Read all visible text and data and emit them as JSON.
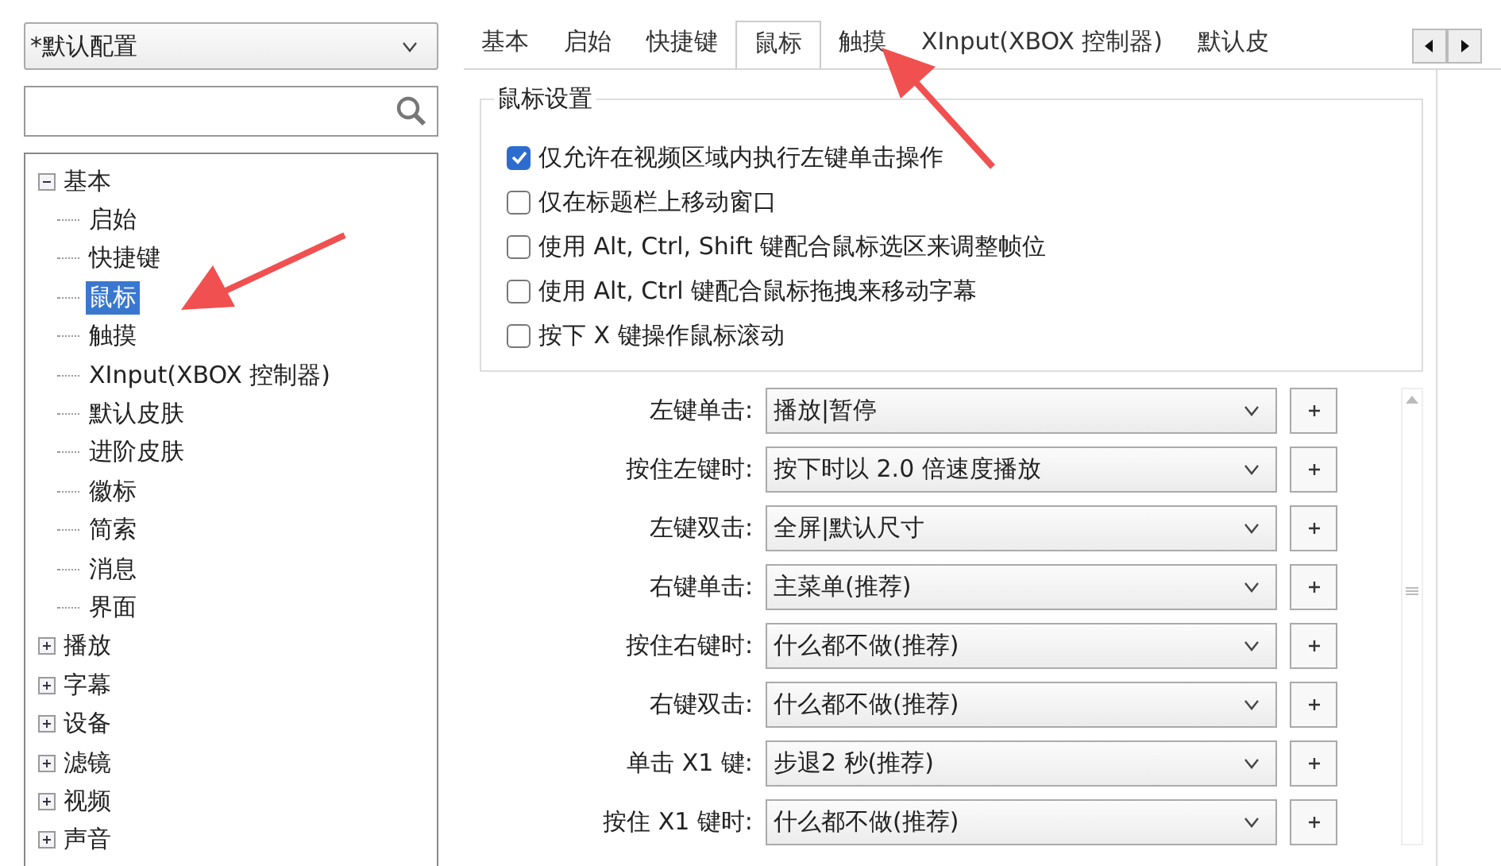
{
  "profile_select": {
    "value": "*默认配置"
  },
  "tree": [
    {
      "label": "基本",
      "expanded": true,
      "selected": false,
      "children": [
        {
          "label": "启始",
          "selected": false
        },
        {
          "label": "快捷键",
          "selected": false
        },
        {
          "label": "鼠标",
          "selected": true
        },
        {
          "label": "触摸",
          "selected": false
        },
        {
          "label": "XInput(XBOX 控制器)",
          "selected": false
        },
        {
          "label": "默认皮肤",
          "selected": false
        },
        {
          "label": "进阶皮肤",
          "selected": false
        },
        {
          "label": "徽标",
          "selected": false
        },
        {
          "label": "简索",
          "selected": false
        },
        {
          "label": "消息",
          "selected": false
        },
        {
          "label": "界面",
          "selected": false
        }
      ]
    },
    {
      "label": "播放",
      "expanded": false,
      "selected": false
    },
    {
      "label": "字幕",
      "expanded": false,
      "selected": false
    },
    {
      "label": "设备",
      "expanded": false,
      "selected": false
    },
    {
      "label": "滤镜",
      "expanded": false,
      "selected": false
    },
    {
      "label": "视频",
      "expanded": false,
      "selected": false
    },
    {
      "label": "声音",
      "expanded": false,
      "selected": false
    }
  ],
  "tabs": [
    {
      "label": "基本",
      "selected": false
    },
    {
      "label": "启始",
      "selected": false
    },
    {
      "label": "快捷键",
      "selected": false
    },
    {
      "label": "鼠标",
      "selected": true
    },
    {
      "label": "触摸",
      "selected": false
    },
    {
      "label": "XInput(XBOX 控制器)",
      "selected": false
    },
    {
      "label": "默认皮",
      "selected": false
    }
  ],
  "group": {
    "title": "鼠标设置",
    "options": [
      {
        "label": "仅允许在视频区域内执行左键单击操作",
        "checked": true
      },
      {
        "label": "仅在标题栏上移动窗口",
        "checked": false
      },
      {
        "label": "使用 Alt, Ctrl, Shift 键配合鼠标选区来调整帧位",
        "checked": false
      },
      {
        "label": "使用 Alt, Ctrl 键配合鼠标拖拽来移动字幕",
        "checked": false
      },
      {
        "label": "按下 X 键操作鼠标滚动",
        "checked": false
      }
    ]
  },
  "bindings": [
    {
      "label": "左键单击:",
      "value": "播放|暂停"
    },
    {
      "label": "按住左键时:",
      "value": "按下时以 2.0 倍速度播放"
    },
    {
      "label": "左键双击:",
      "value": "全屏|默认尺寸"
    },
    {
      "label": "右键单击:",
      "value": "主菜单(推荐)"
    },
    {
      "label": "按住右键时:",
      "value": "什么都不做(推荐)"
    },
    {
      "label": "右键双击:",
      "value": "什么都不做(推荐)"
    },
    {
      "label": "单击 X1 键:",
      "value": "步退2 秒(推荐)"
    },
    {
      "label": "按住 X1 键时:",
      "value": "什么都不做(推荐)"
    }
  ]
}
